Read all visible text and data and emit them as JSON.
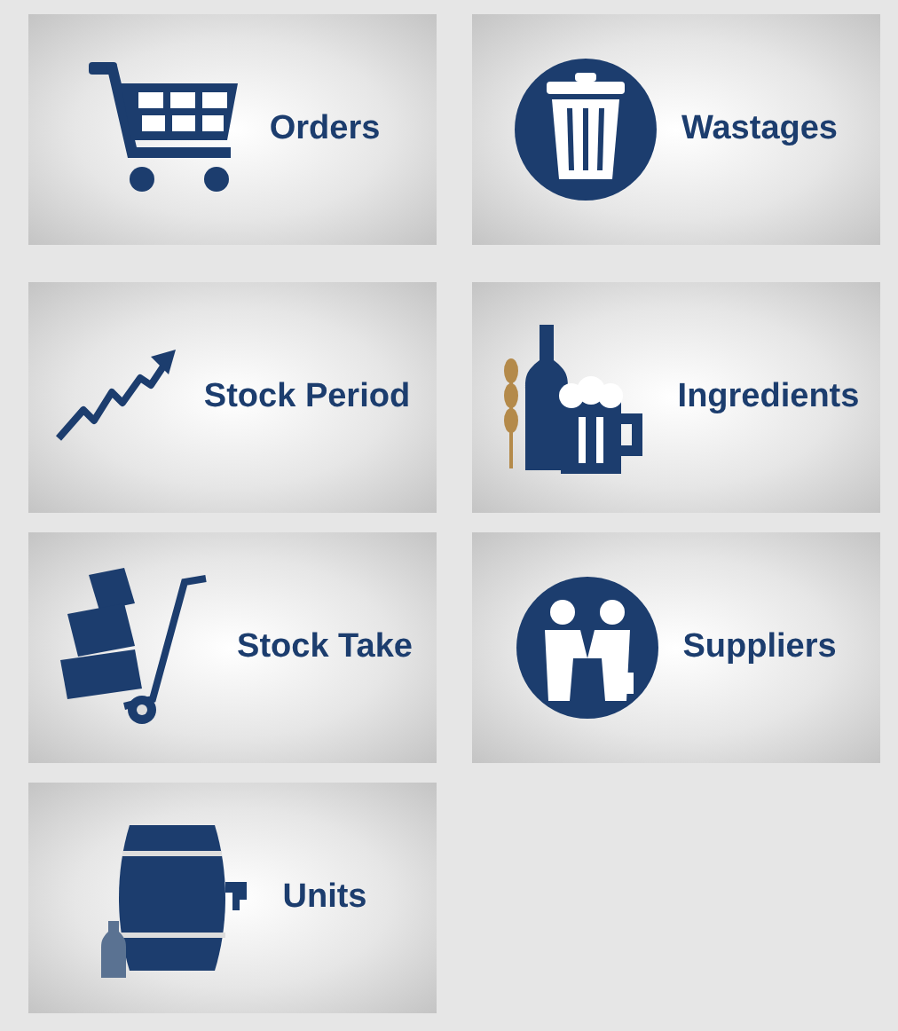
{
  "tiles": [
    {
      "label": "Orders",
      "kind": "cart"
    },
    {
      "label": "Wastages",
      "kind": "bin"
    },
    {
      "label": "Stock Period",
      "kind": "chart"
    },
    {
      "label": "Ingredients",
      "kind": "drinks"
    },
    {
      "label": "Stock Take",
      "kind": "trolley"
    },
    {
      "label": "Suppliers",
      "kind": "handshake"
    },
    {
      "label": "Units",
      "kind": "keg"
    }
  ]
}
